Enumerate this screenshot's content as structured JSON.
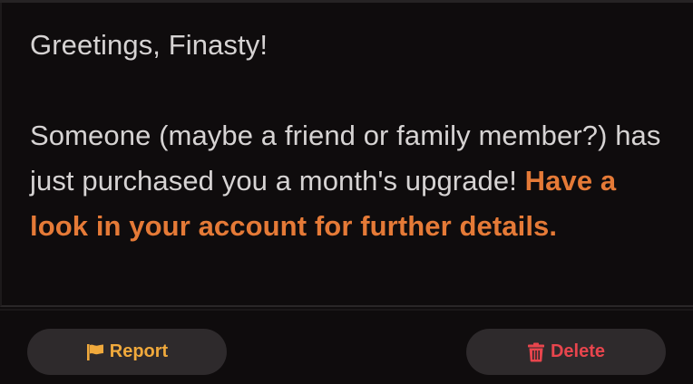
{
  "message": {
    "greeting": "Greetings, Finasty!",
    "body_text": "Someone (maybe a friend or family member?) has just purchased you a month's upgrade! ",
    "body_highlight": "Have a look in your account for further details."
  },
  "footer": {
    "report_label": "Report",
    "delete_label": "Delete"
  },
  "icons": {
    "report": "flag-icon",
    "delete": "trash-icon"
  },
  "colors": {
    "background": "#0f0c0d",
    "text": "#d6d3d3",
    "highlight": "#e57a37",
    "button_bg": "#2e2a2c",
    "report": "#f0a93c",
    "delete": "#e8454d"
  }
}
